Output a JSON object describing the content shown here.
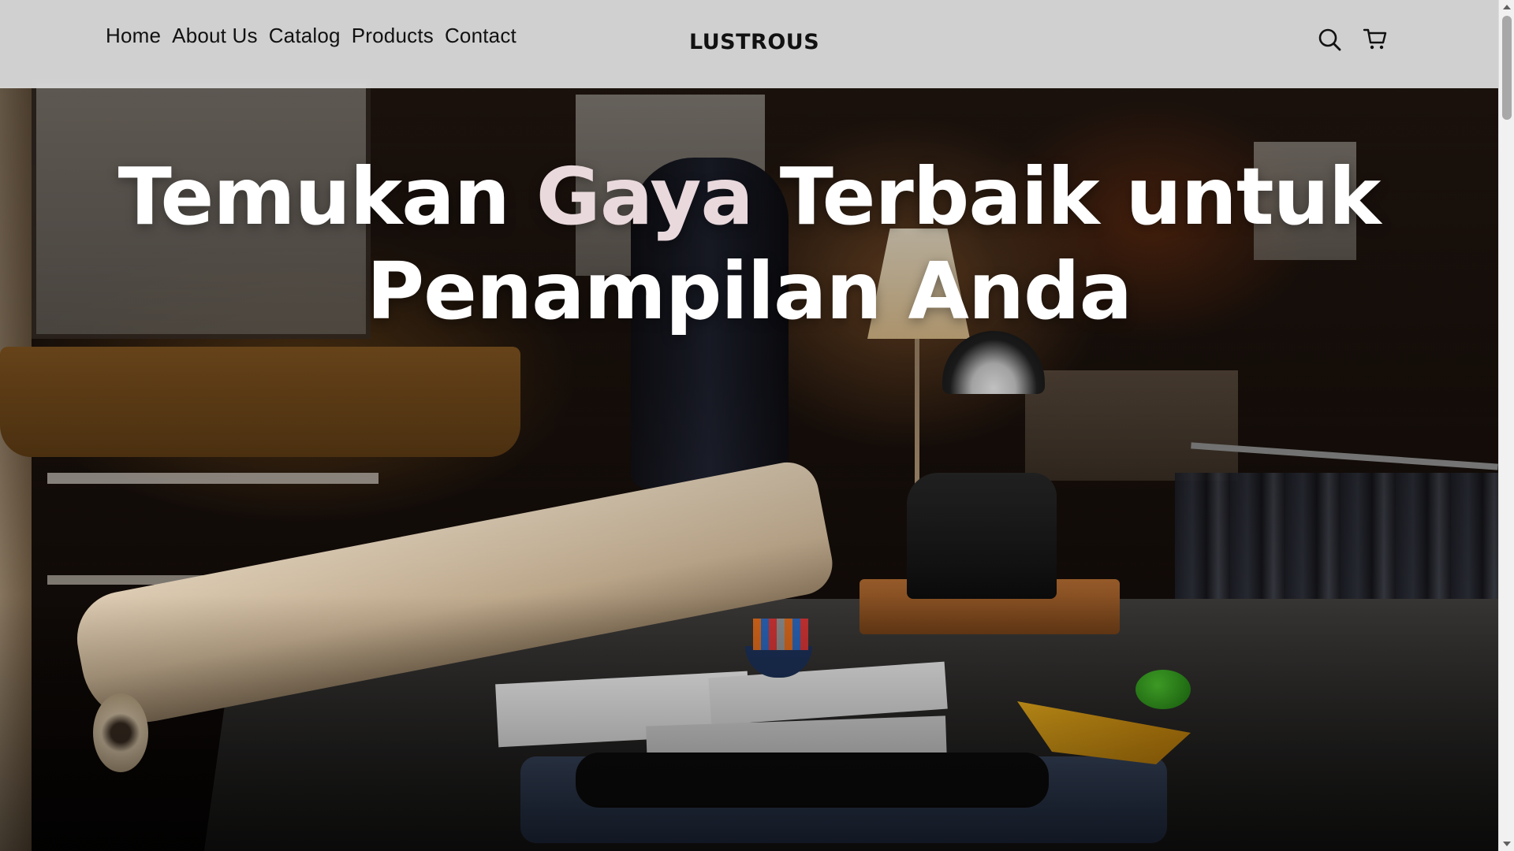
{
  "nav": {
    "links": [
      "Home",
      "About Us",
      "Catalog",
      "Products",
      "Contact"
    ],
    "brand": "LUSTROUS",
    "icons": [
      "search-icon",
      "cart-icon"
    ]
  },
  "hero": {
    "headline_part1": "Temukan ",
    "headline_accent": "Gaya",
    "headline_part2": " Terbaik untuk",
    "headline_line2": "Penampilan Anda",
    "background_description_name": "tailor-workshop-photo"
  },
  "colors": {
    "navbar_bg": "#d8d8d8",
    "headline_text": "#ffffff",
    "headline_accent": "#e9d9dc",
    "nav_text": "#111111"
  }
}
